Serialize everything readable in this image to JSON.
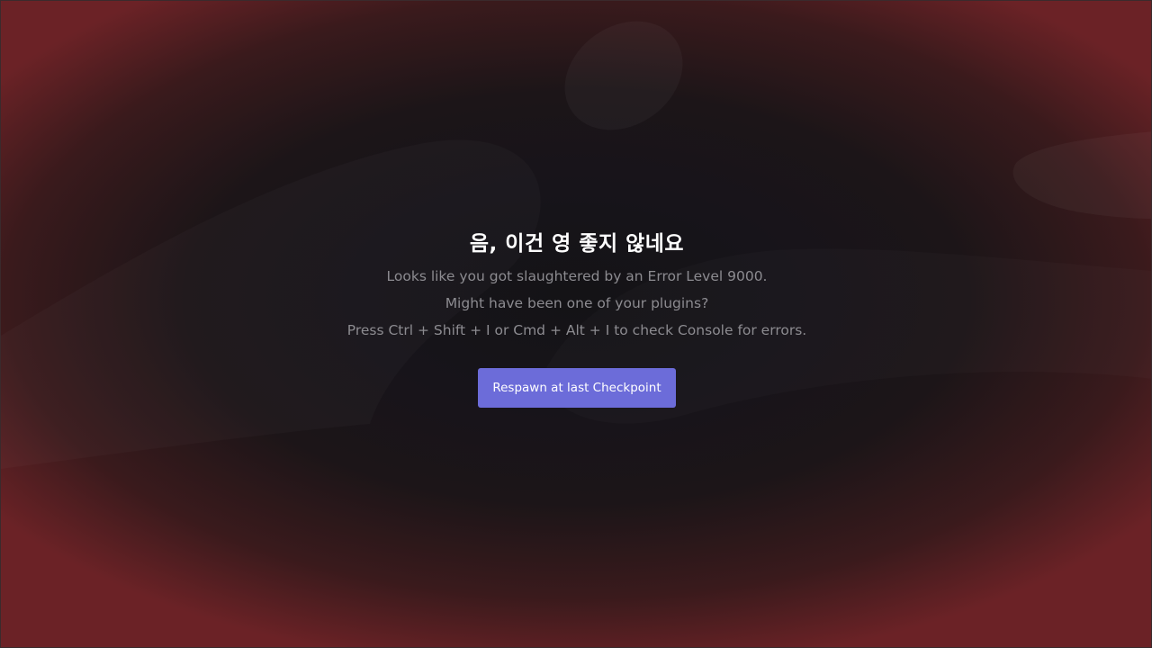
{
  "error": {
    "title": "음, 이건 영 좋지 않네요",
    "lines": [
      "Looks like you got slaughtered by an Error Level 9000.",
      "Might have been one of your plugins?",
      "Press Ctrl + Shift + I or Cmd + Alt + I to check Console for errors."
    ],
    "button_label": "Respawn at last Checkpoint"
  },
  "colors": {
    "accent": "#6c6cd9",
    "background": "#141316",
    "vignette": "#6b2226",
    "text_primary": "#ffffff",
    "text_muted": "#8c8b90"
  }
}
